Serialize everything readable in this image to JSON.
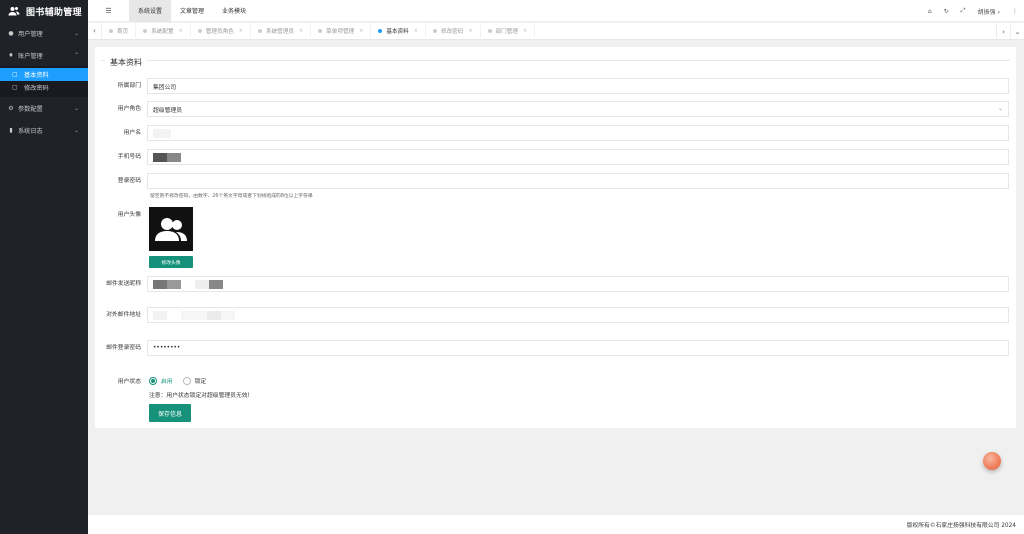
{
  "app": {
    "title": "图书辅助管理"
  },
  "sidebar": {
    "items": [
      {
        "label": "用户管理",
        "icon": "user-icon"
      },
      {
        "label": "账户管理",
        "icon": "account-icon"
      },
      {
        "label": "参数配置",
        "icon": "settings-icon"
      },
      {
        "label": "系统日志",
        "icon": "log-icon"
      }
    ],
    "account_sub": [
      {
        "label": "基本资料",
        "active": true
      },
      {
        "label": "修改密码",
        "active": false
      }
    ]
  },
  "topbar": {
    "nav": [
      {
        "label": "系统设置",
        "active": true
      },
      {
        "label": "文章管理",
        "active": false
      },
      {
        "label": "业务模块",
        "active": false
      }
    ],
    "user": "胡振强"
  },
  "tabs": [
    {
      "label": "首页",
      "active": false
    },
    {
      "label": "系统配置",
      "active": false
    },
    {
      "label": "管理员角色",
      "active": false
    },
    {
      "label": "系统管理员",
      "active": false
    },
    {
      "label": "菜单项管理",
      "active": false
    },
    {
      "label": "基本资料",
      "active": true
    },
    {
      "label": "修改密码",
      "active": false
    },
    {
      "label": "部门管理",
      "active": false
    }
  ],
  "form": {
    "legend": "基本资料",
    "department": {
      "label": "所属部门",
      "value": "集团公司"
    },
    "role": {
      "label": "用户角色",
      "value": "超级管理员"
    },
    "username": {
      "label": "用户名",
      "value": ""
    },
    "phone": {
      "label": "手机号码",
      "value": ""
    },
    "password": {
      "label": "登录密码",
      "value": "",
      "hint": "留空则不修改密码，由数字、26个英文字母或者下划线组成的8位以上字符串"
    },
    "avatar": {
      "label": "用户头像",
      "button": "修改头像"
    },
    "mail_nick": {
      "label": "邮件发送昵称",
      "value": ""
    },
    "mail_addr": {
      "label": "对外邮件地址",
      "value": ""
    },
    "mail_pwd": {
      "label": "邮件登录密码",
      "value": "••••••••"
    },
    "status": {
      "label": "用户状态",
      "options": [
        {
          "label": "启用",
          "checked": true
        },
        {
          "label": "锁定",
          "checked": false
        }
      ],
      "note": "注意：用户状态锁定对超级管理员无效!"
    },
    "save_label": "保存信息"
  },
  "footer": {
    "copyright": "版权所有©石家庄扬强科技有限公司 2024"
  },
  "colors": {
    "sidebar_bg": "#20222a",
    "active_blue": "#1e9fff",
    "primary_green": "#16927b"
  }
}
